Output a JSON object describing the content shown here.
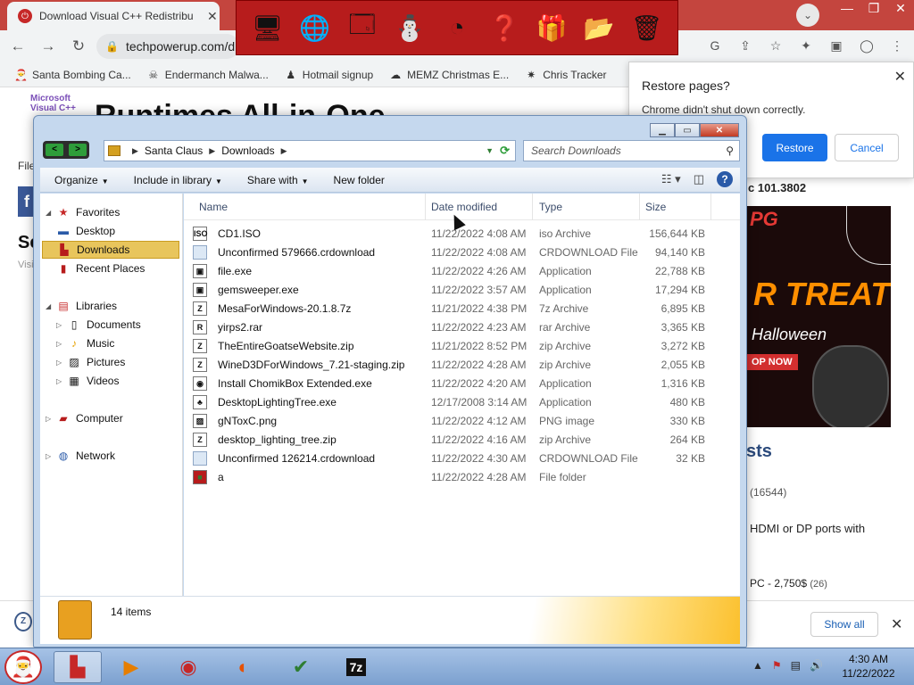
{
  "browser": {
    "tab_title": "Download Visual C++ Redistribu",
    "tab_close": "✕",
    "url": "techpowerup.com/d",
    "bookmarks": [
      {
        "label": "Santa Bombing Ca...",
        "icon": "santa-icon"
      },
      {
        "label": "Endermanch Malwa...",
        "icon": "skull-icon"
      },
      {
        "label": "Hotmail signup",
        "icon": "person-icon"
      },
      {
        "label": "MEMZ Christmas E...",
        "icon": "memz-icon"
      },
      {
        "label": "Chris Tracker",
        "icon": "star-icon"
      }
    ],
    "page": {
      "logo_line1": "Microsoft",
      "logo_line2": "Visual C++",
      "heading": "Runtimes All-in-One",
      "side_text": "File",
      "fb_letter": "f",
      "se_text": "Se",
      "vis_text": "Visi",
      "ad_version": "c 101.3802",
      "ad_brand": "PG",
      "ad_treat": "R TREAT",
      "ad_halloween": "Halloween",
      "ad_shop": "OP NOW",
      "sts": "sts",
      "sts_count": "(16544)",
      "hdmi": "HDMI or DP ports with",
      "pc_price": "PC - 2,750$",
      "pc_count": "(26)"
    },
    "restore": {
      "title": "Restore pages?",
      "message": "Chrome didn't shut down correctly.",
      "restore_label": "Restore",
      "cancel_label": "Cancel"
    },
    "downloads_shelf": {
      "show_all": "Show all"
    }
  },
  "explorer": {
    "breadcrumb": [
      "Santa Claus",
      "Downloads"
    ],
    "search_placeholder": "Search Downloads",
    "commands": [
      "Organize",
      "Include in library",
      "Share with",
      "New folder"
    ],
    "nav": {
      "favorites": "Favorites",
      "desktop": "Desktop",
      "downloads": "Downloads",
      "recent": "Recent Places",
      "libraries": "Libraries",
      "documents": "Documents",
      "music": "Music",
      "pictures": "Pictures",
      "videos": "Videos",
      "computer": "Computer",
      "network": "Network"
    },
    "columns": {
      "name": "Name",
      "date": "Date modified",
      "type": "Type",
      "size": "Size"
    },
    "files": [
      {
        "name": "CD1.ISO",
        "date": "11/22/2022 4:08 AM",
        "type": "iso Archive",
        "size": "156,644 KB",
        "icon": "ISO"
      },
      {
        "name": "Unconfirmed 579666.crdownload",
        "date": "11/22/2022 4:08 AM",
        "type": "CRDOWNLOAD File",
        "size": "94,140 KB",
        "icon": ""
      },
      {
        "name": "file.exe",
        "date": "11/22/2022 4:26 AM",
        "type": "Application",
        "size": "22,788 KB",
        "icon": "▣"
      },
      {
        "name": "gemsweeper.exe",
        "date": "11/22/2022 3:57 AM",
        "type": "Application",
        "size": "17,294 KB",
        "icon": "▣"
      },
      {
        "name": "MesaForWindows-20.1.8.7z",
        "date": "11/21/2022 4:38 PM",
        "type": "7z Archive",
        "size": "6,895 KB",
        "icon": "Z"
      },
      {
        "name": "yirps2.rar",
        "date": "11/22/2022 4:23 AM",
        "type": "rar Archive",
        "size": "3,365 KB",
        "icon": "R"
      },
      {
        "name": "TheEntireGoatseWebsite.zip",
        "date": "11/21/2022 8:52 PM",
        "type": "zip Archive",
        "size": "3,272 KB",
        "icon": "Z"
      },
      {
        "name": "WineD3DForWindows_7.21-staging.zip",
        "date": "11/22/2022 4:28 AM",
        "type": "zip Archive",
        "size": "2,055 KB",
        "icon": "Z"
      },
      {
        "name": "Install ChomikBox Extended.exe",
        "date": "11/22/2022 4:20 AM",
        "type": "Application",
        "size": "1,316 KB",
        "icon": "◉"
      },
      {
        "name": "DesktopLightingTree.exe",
        "date": "12/17/2008 3:14 AM",
        "type": "Application",
        "size": "480 KB",
        "icon": "♣"
      },
      {
        "name": "gNToxC.png",
        "date": "11/22/2022 4:12 AM",
        "type": "PNG image",
        "size": "330 KB",
        "icon": "▨"
      },
      {
        "name": "desktop_lighting_tree.zip",
        "date": "11/22/2022 4:16 AM",
        "type": "zip Archive",
        "size": "264 KB",
        "icon": "Z"
      },
      {
        "name": "Unconfirmed 126214.crdownload",
        "date": "11/22/2022 4:30 AM",
        "type": "CRDOWNLOAD File",
        "size": "32 KB",
        "icon": ""
      },
      {
        "name": "a",
        "date": "11/22/2022 4:28 AM",
        "type": "File folder",
        "size": "",
        "icon": "■"
      }
    ],
    "item_count": "14 items"
  },
  "taskbar": {
    "time": "4:30 AM",
    "date": "11/22/2022",
    "apps": [
      "folder-icon",
      "media-icon",
      "chrome-icon",
      "firefox-icon",
      "checklist-icon",
      "7zip-icon"
    ]
  }
}
